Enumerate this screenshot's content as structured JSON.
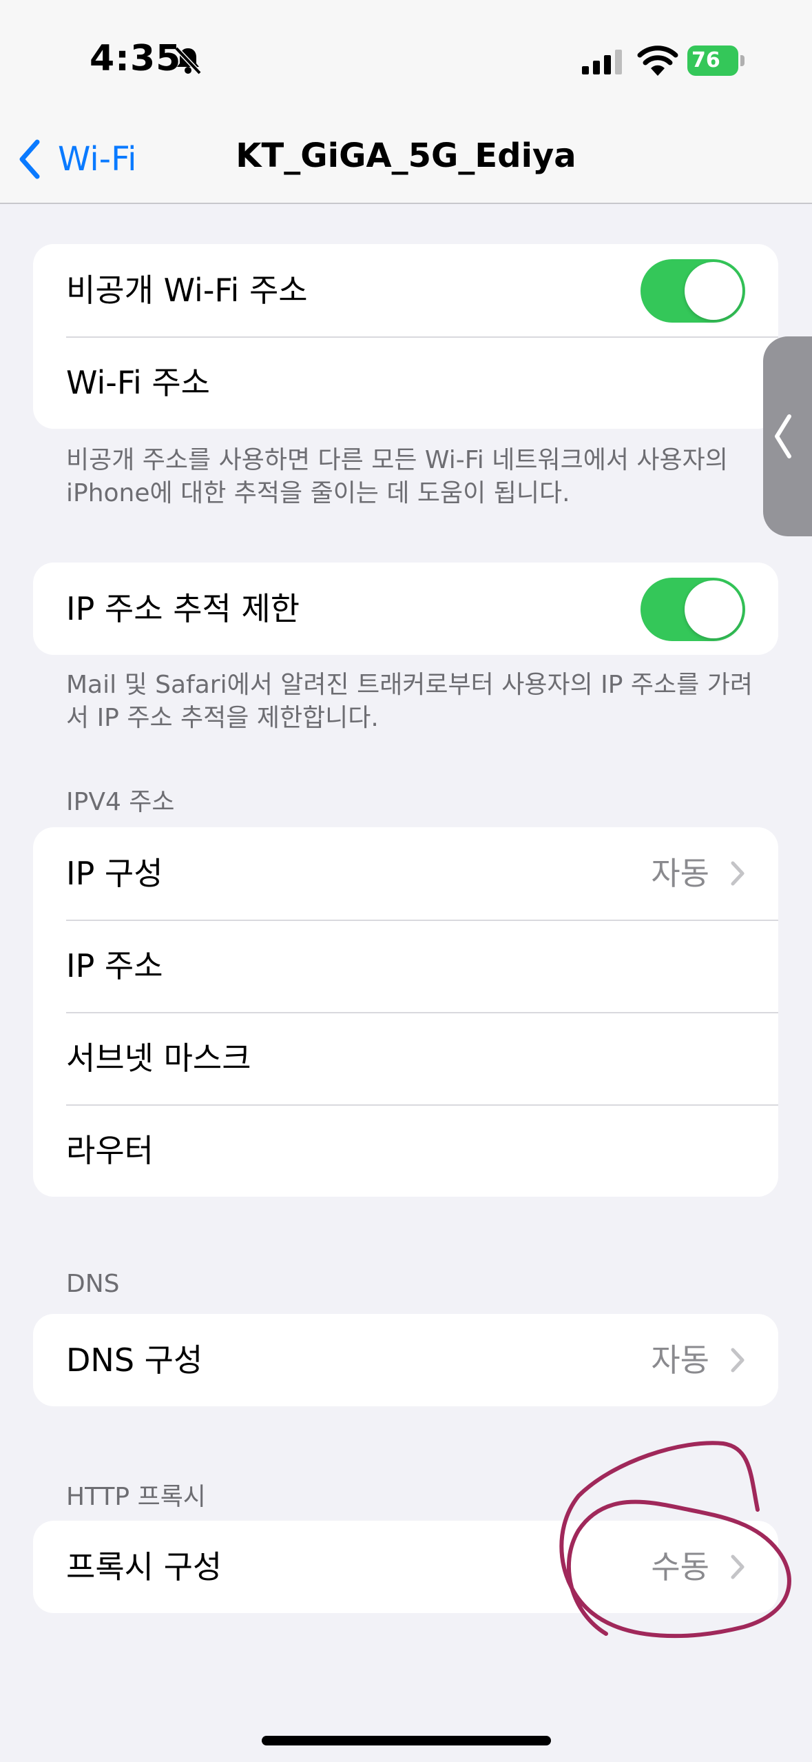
{
  "status_bar": {
    "time": "4:35",
    "battery_level": "76",
    "icons": [
      "bell-slash-icon",
      "cellular-signal-icon",
      "wifi-icon",
      "battery-icon"
    ]
  },
  "nav": {
    "back_label": "Wi-Fi",
    "title": "KT_GiGA_5G_Ediya"
  },
  "private_group": {
    "private_address_label": "비공개 Wi-Fi 주소",
    "private_address_on": true,
    "wifi_address_label": "Wi-Fi 주소",
    "footer": "비공개 주소를 사용하면 다른 모든 Wi-Fi 네트워크에서 사용자의 iPhone에 대한 추적을 줄이는 데 도움이 됩니다."
  },
  "tracking_group": {
    "limit_ip_label": "IP 주소 추적 제한",
    "limit_ip_on": true,
    "footer": "Mail 및 Safari에서 알려진 트래커로부터 사용자의 IP 주소를 가려서 IP 주소 추적을 제한합니다."
  },
  "ipv4_group": {
    "header": "IPV4 주소",
    "configure_ip_label": "IP 구성",
    "configure_ip_value": "자동",
    "ip_address_label": "IP 주소",
    "subnet_mask_label": "서브넷 마스크",
    "router_label": "라우터"
  },
  "dns_group": {
    "header": "DNS",
    "configure_dns_label": "DNS 구성",
    "configure_dns_value": "자동"
  },
  "proxy_group": {
    "header": "HTTP 프록시",
    "configure_proxy_label": "프록시 구성",
    "configure_proxy_value": "수동"
  },
  "colors": {
    "accent": "#0a7aff",
    "toggle_on": "#34c759",
    "background": "#f2f2f7",
    "annotation": "#a0285a"
  }
}
